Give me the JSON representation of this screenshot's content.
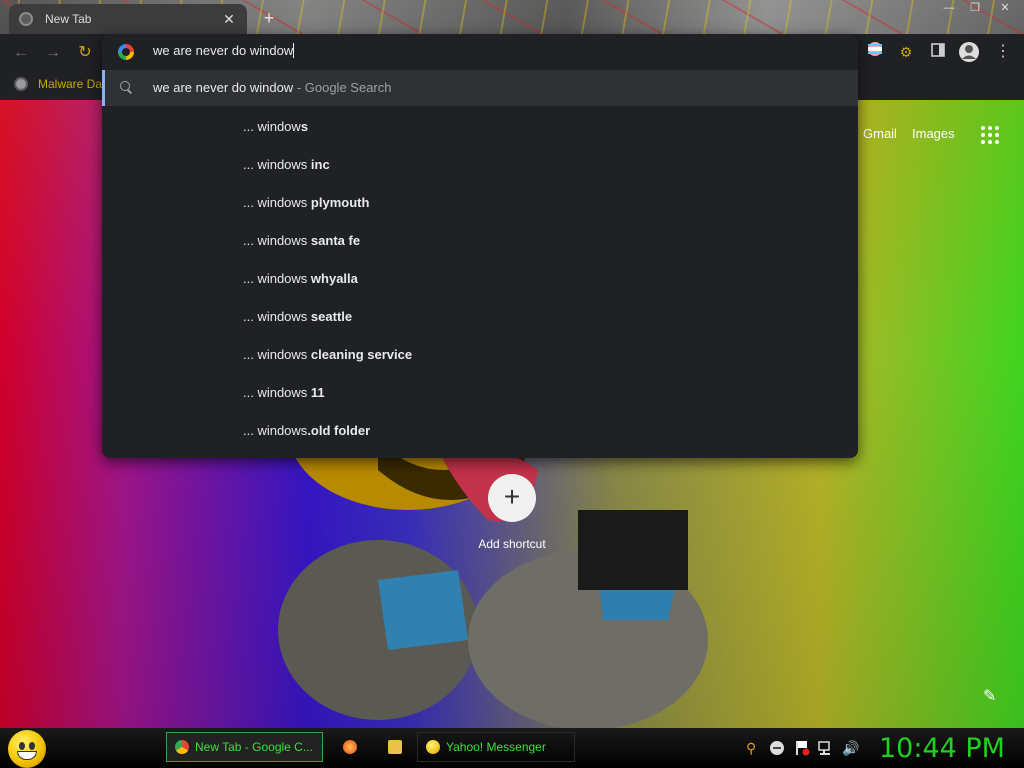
{
  "browser": {
    "tab_title": "New Tab",
    "tab_close": "✕",
    "new_tab": "+"
  },
  "toolbar": {
    "back": "←",
    "forward": "→",
    "reload": "↻",
    "menu": "⋮"
  },
  "bookmarks": {
    "items": [
      {
        "label": "Malware Da"
      }
    ]
  },
  "omnibox": {
    "input_value": "we are never do window",
    "selected_suggestion": {
      "text": "we are never do window",
      "suffix": " - Google Search"
    },
    "suggestions": [
      {
        "prefix": "... window",
        "bold": "s"
      },
      {
        "prefix": "... windows",
        "bold": " inc"
      },
      {
        "prefix": "... windows",
        "bold": " plymouth"
      },
      {
        "prefix": "... windows",
        "bold": " santa fe"
      },
      {
        "prefix": "... windows",
        "bold": " whyalla"
      },
      {
        "prefix": "... windows",
        "bold": " seattle"
      },
      {
        "prefix": "... windows",
        "bold": " cleaning service"
      },
      {
        "prefix": "... windows",
        "bold": " 11"
      },
      {
        "prefix": "... windows",
        "bold": ".old folder"
      }
    ]
  },
  "newtab": {
    "gmail": "Gmail",
    "images": "Images",
    "add_shortcut": "Add shortcut",
    "add_symbol": "+"
  },
  "taskbar": {
    "items": [
      {
        "label": "New Tab - Google C..."
      },
      {
        "label": "Yahoo! Messenger"
      }
    ],
    "clock": "10:44 PM"
  },
  "colors": {
    "accent_green": "#1fd21f",
    "omnibox_bg": "#202124",
    "selected_bar": "#8ab4f8",
    "bookmark_text": "#c9a900"
  }
}
